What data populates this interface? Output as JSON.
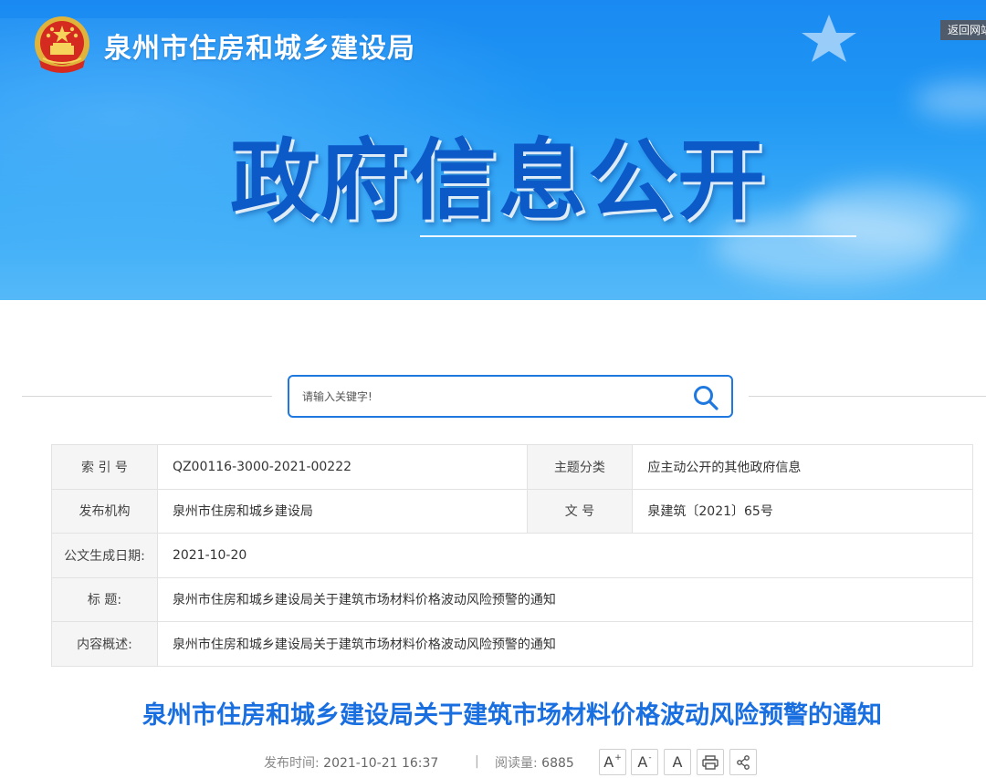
{
  "header": {
    "org_name": "泉州市住房和城乡建设局",
    "back_button": "返回网站",
    "banner_title": "政府信息公开",
    "emblem_icon": "national-emblem-icon"
  },
  "search": {
    "placeholder": "请输入关键字!",
    "icon": "search-icon"
  },
  "info_table": {
    "index_no_label": "索 引 号",
    "index_no_value": "QZ00116-3000-2021-00222",
    "topic_label": "主题分类",
    "topic_value": "应主动公开的其他政府信息",
    "publisher_label": "发布机构",
    "publisher_value": "泉州市住房和城乡建设局",
    "doc_no_label": "文 号",
    "doc_no_value": "泉建筑〔2021〕65号",
    "date_label": "公文生成日期:",
    "date_value": "2021-10-20",
    "title_label": "标 题:",
    "title_value": "泉州市住房和城乡建设局关于建筑市场材料价格波动风险预警的通知",
    "summary_label": "内容概述:",
    "summary_value": "泉州市住房和城乡建设局关于建筑市场材料价格波动风险预警的通知"
  },
  "article": {
    "title": "泉州市住房和城乡建设局关于建筑市场材料价格波动风险预警的通知",
    "publish_time_label": "发布时间:",
    "publish_time_value": "2021-10-21 16:37",
    "separator": "|",
    "read_count_label": "阅读量:",
    "read_count_value": "6885",
    "font_increase": "A",
    "font_decrease": "A",
    "font_reset": "A",
    "font_increase_mark": "+",
    "font_decrease_mark": "-"
  },
  "colors": {
    "accent": "#1a6fe0",
    "search_border": "#1f78e0",
    "banner_title": "#0c59c8"
  }
}
